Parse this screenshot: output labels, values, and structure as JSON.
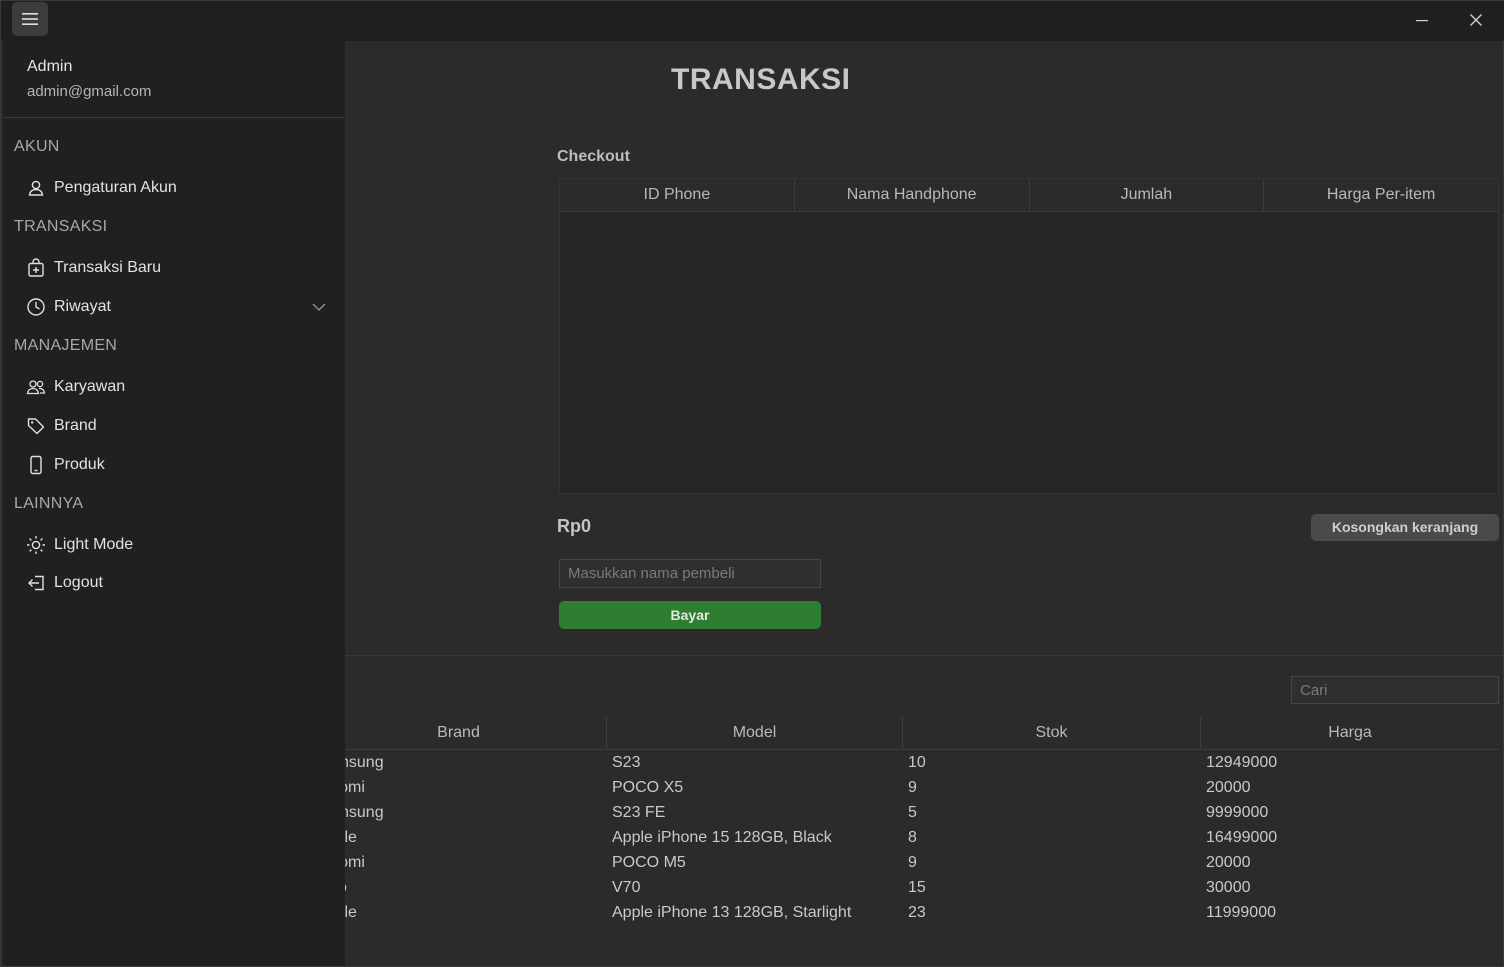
{
  "window": {
    "menu_icon": "hamburger-icon",
    "minimize_icon": "minimize-icon",
    "close_icon": "close-icon"
  },
  "sidebar": {
    "user": {
      "name": "Admin",
      "email": "admin@gmail.com"
    },
    "sections": {
      "akun": "AKUN",
      "transaksi": "TRANSAKSI",
      "manajemen": "MANAJEMEN",
      "lainnya": "LAINNYA"
    },
    "items": [
      {
        "label": "Pengaturan Akun",
        "icon": "user-icon"
      },
      {
        "label": "Transaksi Baru",
        "icon": "shopping-bag-plus-icon"
      },
      {
        "label": "Riwayat",
        "icon": "clock-icon"
      },
      {
        "label": "Karyawan",
        "icon": "people-icon"
      },
      {
        "label": "Brand",
        "icon": "tag-icon"
      },
      {
        "label": "Produk",
        "icon": "phone-icon"
      },
      {
        "label": "Light Mode",
        "icon": "sun-icon"
      },
      {
        "label": "Logout",
        "icon": "logout-icon"
      }
    ]
  },
  "main": {
    "title": "TRANSAKSI",
    "checkout_label": "Checkout",
    "cart_columns": [
      "ID Phone",
      "Nama Handphone",
      "Jumlah",
      "Harga Per-item"
    ],
    "total": "Rp0",
    "clear_button": "Kosongkan keranjang",
    "buyer_placeholder": "Masukkan nama pembeli",
    "pay_button": "Bayar",
    "search_placeholder": "Cari"
  },
  "products": {
    "columns": [
      "Brand",
      "Model",
      "Stok",
      "Harga"
    ],
    "rows": [
      [
        "Samsung",
        "S23",
        "10",
        "12949000"
      ],
      [
        "Xiaomi",
        "POCO X5",
        "9",
        "20000"
      ],
      [
        "Samsung",
        "S23 FE",
        "5",
        "9999000"
      ],
      [
        "Apple",
        "Apple iPhone 15 128GB, Black",
        "8",
        "16499000"
      ],
      [
        "Xiaomi",
        "POCO M5",
        "9",
        "20000"
      ],
      [
        "Vivo",
        "V70",
        "15",
        "30000"
      ],
      [
        "Apple",
        "Apple iPhone 13 128GB, Starlight",
        "23",
        "11999000"
      ]
    ]
  }
}
